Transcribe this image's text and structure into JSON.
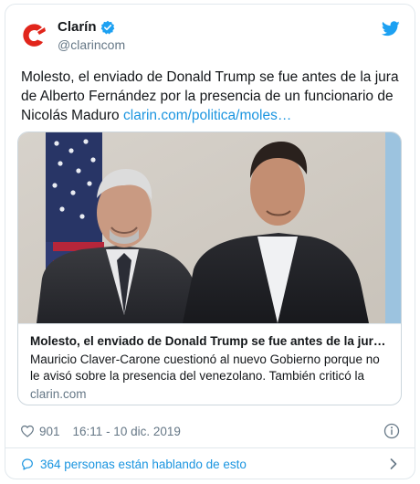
{
  "account": {
    "display_name": "Clarín",
    "handle": "@clarincom",
    "verified": true,
    "avatar_icon": "clarin-logo-icon",
    "brand_color": "#e1251b"
  },
  "tweet": {
    "text": "Molesto, el enviado de Donald Trump se fue antes de la jura de Alberto Fernández por la presencia de un funcionario de Nicolás Maduro ",
    "link": "clarin.com/politica/moles…"
  },
  "card": {
    "title": "Molesto, el enviado de Donald Trump se fue antes de la jur…",
    "description": "Mauricio Claver-Carone cuestionó al nuevo Gobierno porque no le avisó sobre la presencia del venezolano. También criticó la",
    "domain": "clarin.com"
  },
  "meta": {
    "likes": "901",
    "timestamp": "16:11 - 10 dic. 2019"
  },
  "conversation": {
    "label": "364 personas están hablando de esto"
  },
  "colors": {
    "link": "#1b95e0",
    "secondary_text": "#657786",
    "twitter_blue": "#1da1f2"
  },
  "icons": {
    "bird": "twitter-bird-icon",
    "verified": "verified-badge-icon",
    "heart": "heart-icon",
    "info": "info-icon",
    "conversation": "speech-bubble-icon",
    "chevron": "chevron-right-icon"
  }
}
